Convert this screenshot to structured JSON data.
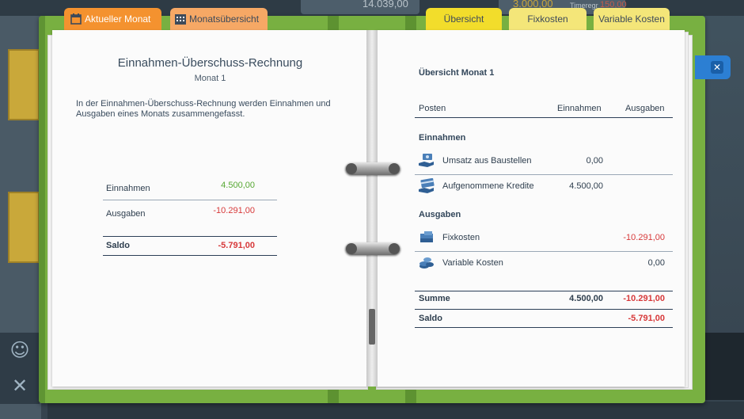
{
  "background": {
    "top_value_1": "14.039,00",
    "top_value_2": "3.000,00",
    "top_label_small": "Timeregr",
    "top_value_small": "150,00"
  },
  "tabs_left": [
    {
      "label": "Aktueller Monat",
      "icon": "calendar-icon",
      "active": true
    },
    {
      "label": "Monatsübersicht",
      "icon": "grid-calendar-icon",
      "active": false
    }
  ],
  "tabs_right": [
    {
      "label": "Übersicht",
      "active": true
    },
    {
      "label": "Fixkosten",
      "active": false
    },
    {
      "label": "Variable Kosten",
      "active": false
    }
  ],
  "close_label": "✕",
  "left_page": {
    "title": "Einnahmen-Überschuss-Rechnung",
    "subtitle": "Monat 1",
    "description": "In der Einnahmen-Überschuss-Rechnung werden Einnahmen und Ausgaben eines Monats zusammengefasst.",
    "income_label": "Einnahmen",
    "income_value": "4.500,00",
    "expense_label": "Ausgaben",
    "expense_value": "-10.291,00",
    "balance_label": "Saldo",
    "balance_value": "-5.791,00"
  },
  "right_page": {
    "title": "Übersicht Monat 1",
    "col_posten": "Posten",
    "col_income": "Einnahmen",
    "col_expense": "Ausgaben",
    "section_income": "Einnahmen",
    "section_expense": "Ausgaben",
    "income_rows": [
      {
        "label": "Umsatz aus Baustellen",
        "income": "0,00",
        "expense": "",
        "icon": "money-hand-icon"
      },
      {
        "label": "Aufgenommene Kredite",
        "income": "4.500,00",
        "expense": "",
        "icon": "credit-card-icon"
      }
    ],
    "expense_rows": [
      {
        "label": "Fixkosten",
        "income": "",
        "expense": "-10.291,00",
        "icon": "cash-stack-icon"
      },
      {
        "label": "Variable Kosten",
        "income": "",
        "expense": "0,00",
        "icon": "coins-stack-icon"
      }
    ],
    "sum_label": "Summe",
    "sum_income": "4.500,00",
    "sum_expense": "-10.291,00",
    "balance_label": "Saldo",
    "balance_value": "-5.791,00"
  }
}
